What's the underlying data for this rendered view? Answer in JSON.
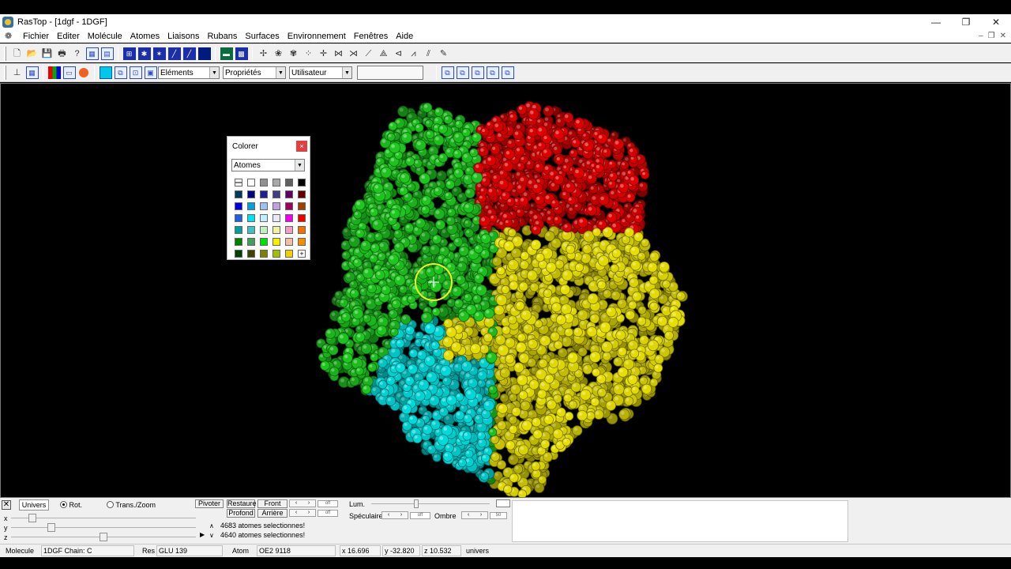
{
  "window": {
    "title": "RasTop - [1dgf - 1DGF]"
  },
  "window_buttons": {
    "minimize": "—",
    "maximize": "❐",
    "close": "✕"
  },
  "menu": [
    "Fichier",
    "Editer",
    "Molécule",
    "Atomes",
    "Liaisons",
    "Rubans",
    "Surfaces",
    "Environnement",
    "Fenêtres",
    "Aide"
  ],
  "toolbar2": {
    "combo1": "Eléments",
    "combo2": "Propriétés",
    "combo3": "Utilisateur"
  },
  "colorer": {
    "title": "Colorer",
    "close": "×",
    "target": "Atomes",
    "swatches": [
      "#ffffff",
      "#ffffff",
      "#909090",
      "#a8a8a8",
      "#606060",
      "#000000",
      "#003a5a",
      "#000080",
      "#202090",
      "#404080",
      "#600060",
      "#600000",
      "#0000e0",
      "#00a0e0",
      "#a0c0f0",
      "#c0a0e0",
      "#a00060",
      "#a04000",
      "#2060e0",
      "#00e0f0",
      "#c0f0ff",
      "#e8e8f8",
      "#f000f0",
      "#f00000",
      "#00a0a0",
      "#40c0c0",
      "#c0f0c0",
      "#f0f0a0",
      "#f0a0c0",
      "#f07000",
      "#008000",
      "#40a060",
      "#00e000",
      "#f0f000",
      "#f0c0a0",
      "#f09000",
      "#004000",
      "#404000",
      "#808000",
      "#a0c000",
      "#f0d000",
      "+"
    ]
  },
  "colors": {
    "chain_green": "#1fc81f",
    "chain_red": "#e00000",
    "chain_yellow": "#e8e000",
    "chain_cyan": "#00dcdc",
    "cursor_circle": "#f0f020"
  },
  "bottom": {
    "univers_label": "Univers",
    "rot_label": "Rot.",
    "trans_label": "Trans./Zoom",
    "axes": [
      "x",
      "y",
      "z"
    ],
    "pivoter": "Pivoter",
    "restaure": "Restaure",
    "profond": "Profond",
    "front": "Front",
    "arriere": "Arrière",
    "lum_label": "Lum.",
    "speculaire_label": "Spéculaire",
    "ombre_label": "Ombre",
    "off1": "off",
    "off2": "off",
    "off3": "off",
    "spec_value": "50",
    "messages": [
      "4683 atomes selectionnes!",
      "4640 atomes selectionnes!"
    ]
  },
  "status": {
    "molecule_label": "Molecule",
    "molecule_value": "1DGF  Chain: C",
    "res_label": "Res",
    "res_value": "GLU 139",
    "atom_label": "Atom",
    "atom_value": "OE2 9118",
    "x_value": "x 16.696",
    "y_value": "y -32.820",
    "z_value": "z 10.532",
    "mode": "univers"
  }
}
